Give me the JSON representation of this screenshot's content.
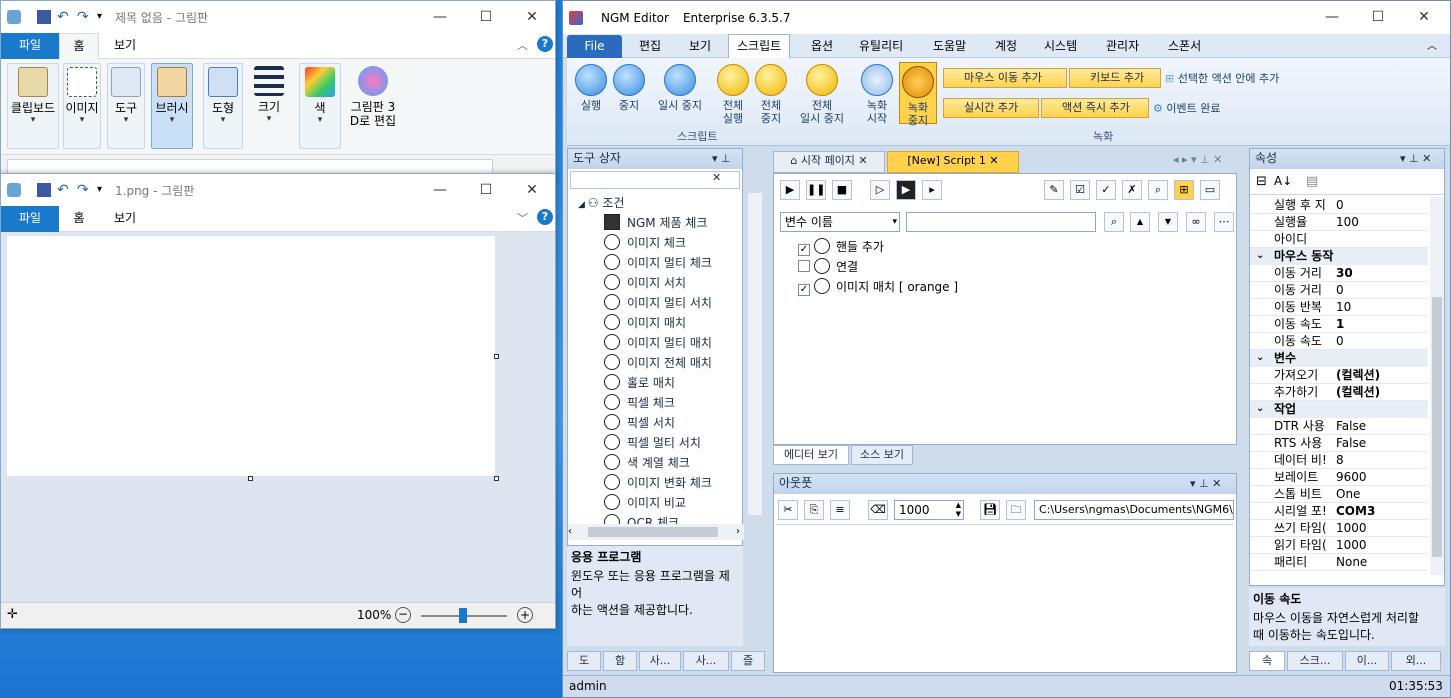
{
  "paint1": {
    "title": "제목 없음 - 그림판",
    "tabs": [
      "파일",
      "홈",
      "보기"
    ],
    "groups": [
      "클립보드",
      "이미지",
      "도구",
      "브러시",
      "도형",
      "크기",
      "색",
      "그림판 3",
      "D로 편집"
    ]
  },
  "paint2": {
    "title": "1.png - 그림판",
    "tabs": [
      "파일",
      "홈",
      "보기"
    ],
    "zoom": "100%"
  },
  "ngm": {
    "title": "NGM Editor",
    "edition": "Enterprise 6.3.5.7",
    "menu": [
      "File",
      "편집",
      "보기",
      "스크립트",
      "옵션",
      "유틸리티",
      "도움말",
      "계정",
      "시스템",
      "관리자",
      "스폰서"
    ],
    "ribbon": {
      "run": "실행",
      "stop": "중지",
      "pause": "일시 중지",
      "run_all_1": "전체",
      "run_all_2": "실행",
      "stop_all_1": "전체",
      "stop_all_2": "중지",
      "pause_all_1": "전체",
      "pause_all_2": "일시 중지",
      "script_group": "스크립트",
      "rec_start_1": "녹화",
      "rec_start_2": "시작",
      "rec_stop_1": "녹화",
      "rec_stop_2": "중지",
      "mouse_add": "마우스 이동 추가",
      "key_add": "키보드 추가",
      "sel_add": "선택한 액션 안에 추가",
      "rt_add": "실시간 추가",
      "instant_add": "액션 즉시 추가",
      "event_done": "이벤트 완료",
      "rec_group": "녹화"
    },
    "toolbox": {
      "title": "도구 상자",
      "root": "조건",
      "items": [
        "NGM 제품 체크",
        "이미지 체크",
        "이미지 멀티 체크",
        "이미지 서치",
        "이미지 멀티 서치",
        "이미지 매치",
        "이미지 멀티 매치",
        "이미지 전체 매치",
        "홀로 매치",
        "픽셀 체크",
        "픽셀 서치",
        "픽셀 멀티 서치",
        "색 계열 체크",
        "이미지 변화 체크",
        "이미지 비교",
        "OCR 체크"
      ],
      "desc_title": "응용 프로그램",
      "desc_text1": "윈도우 또는 응용 프로그램을 제어",
      "desc_text2": "하는 액션을 제공합니다.",
      "bottom_tabs": [
        "도",
        "함",
        "사...",
        "사...",
        "즐"
      ]
    },
    "editor": {
      "tab_start": "시작 페이지",
      "tab_script": "[New] Script 1",
      "var_select": "변수 이름",
      "actions": [
        {
          "label": "핸들 추가",
          "checked": true
        },
        {
          "label": "연결",
          "checked": false
        },
        {
          "label": "이미지 매치 [ orange ]",
          "checked": true
        }
      ],
      "view_editor": "에디터 보기",
      "view_source": "소스 보기"
    },
    "output": {
      "title": "아웃풋",
      "count": "1000",
      "path": "C:\\Users\\ngmas\\Documents\\NGM6\\"
    },
    "props": {
      "title": "속성",
      "rows": [
        {
          "k": "실행 후 지",
          "v": "0"
        },
        {
          "k": "실행율",
          "v": "100"
        },
        {
          "k": "아이디",
          "v": ""
        },
        {
          "cat": "마우스 동작"
        },
        {
          "k": "이동 거리",
          "v": "30",
          "b": true
        },
        {
          "k": "이동 거리",
          "v": "0"
        },
        {
          "k": "이동 반복",
          "v": "10"
        },
        {
          "k": "이동 속도",
          "v": "1",
          "b": true
        },
        {
          "k": "이동 속도",
          "v": "0"
        },
        {
          "cat": "변수"
        },
        {
          "k": "가져오기",
          "v": "(컬렉션)",
          "b": true
        },
        {
          "k": "추가하기",
          "v": "(컬렉션)",
          "b": true
        },
        {
          "cat": "작업"
        },
        {
          "k": "DTR 사용",
          "v": "False"
        },
        {
          "k": "RTS 사용",
          "v": "False"
        },
        {
          "k": "데이터 비!",
          "v": "8"
        },
        {
          "k": "보레이트",
          "v": "9600"
        },
        {
          "k": "스톱 비트",
          "v": "One"
        },
        {
          "k": "시리얼 포!",
          "v": "COM3",
          "b": true
        },
        {
          "k": "쓰기 타임(",
          "v": "1000"
        },
        {
          "k": "읽기 타임(",
          "v": "1000"
        },
        {
          "k": "패리티",
          "v": "None"
        }
      ],
      "desc_title": "이동 속도",
      "desc_text1": "마우스 이동을 자연스럽게 처리할",
      "desc_text2": "때 이동하는 속도입니다.",
      "bottom_tabs": [
        "속",
        "스크...",
        "이...",
        "외..."
      ]
    },
    "status_user": "admin",
    "status_time": "01:35:53"
  },
  "colors": {
    "accent": "#1979ca",
    "ribbon_yellow": "#ffd24a",
    "ngm_bg": "#cfdcec"
  }
}
